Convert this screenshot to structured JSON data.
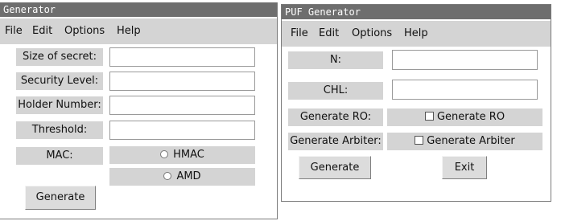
{
  "generator": {
    "title": "Generator",
    "menu": [
      "File",
      "Edit",
      "Options",
      "Help"
    ],
    "fields": [
      {
        "label": "Size of secret:",
        "value": ""
      },
      {
        "label": "Security Level:",
        "value": ""
      },
      {
        "label": "Holder Number:",
        "value": ""
      },
      {
        "label": "Threshold:",
        "value": ""
      }
    ],
    "mac_label": "MAC:",
    "mac_options": [
      "HMAC",
      "AMD"
    ],
    "generate_button": "Generate"
  },
  "puf_generator": {
    "title": "PUF Generator",
    "menu": [
      "File",
      "Edit",
      "Options",
      "Help"
    ],
    "fields": [
      {
        "label": "N:",
        "value": ""
      },
      {
        "label": "CHL:",
        "value": ""
      }
    ],
    "ro_label": "Generate RO:",
    "ro_checkbox": "Generate RO",
    "arbiter_label": "Generate Arbiter:",
    "arbiter_checkbox": "Generate Arbiter",
    "generate_button": "Generate",
    "exit_button": "Exit"
  }
}
